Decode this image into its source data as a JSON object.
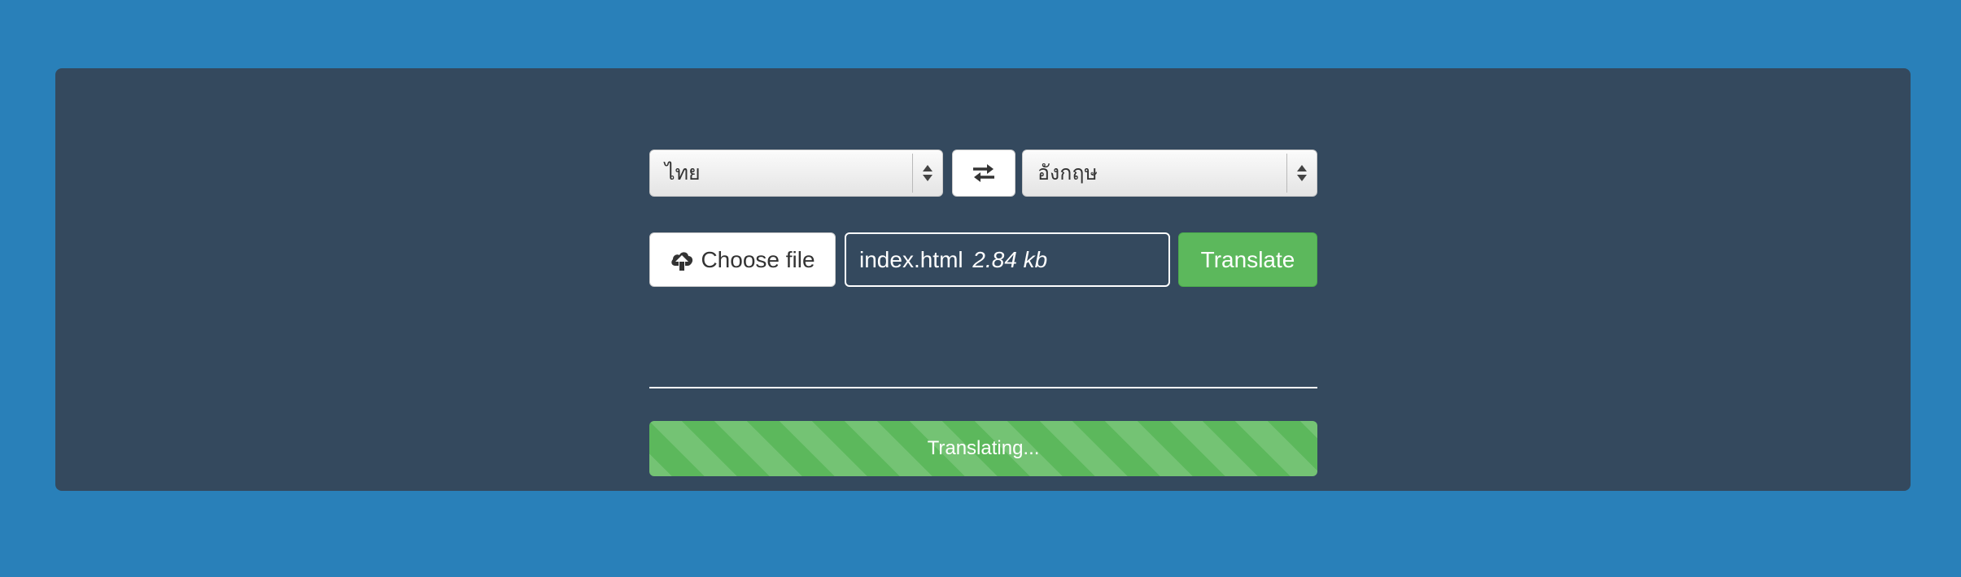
{
  "colors": {
    "background": "#2980b9",
    "panel": "#34495e",
    "success": "#5cb85c"
  },
  "languages": {
    "source": "ไทย",
    "target": "อังกฤษ",
    "swap_icon": "swap-arrows-icon"
  },
  "file": {
    "choose_label": "Choose file",
    "choose_icon": "cloud-upload-icon",
    "name": "index.html",
    "size": "2.84 kb"
  },
  "actions": {
    "translate_label": "Translate"
  },
  "progress": {
    "label": "Translating...",
    "percent": 100
  }
}
